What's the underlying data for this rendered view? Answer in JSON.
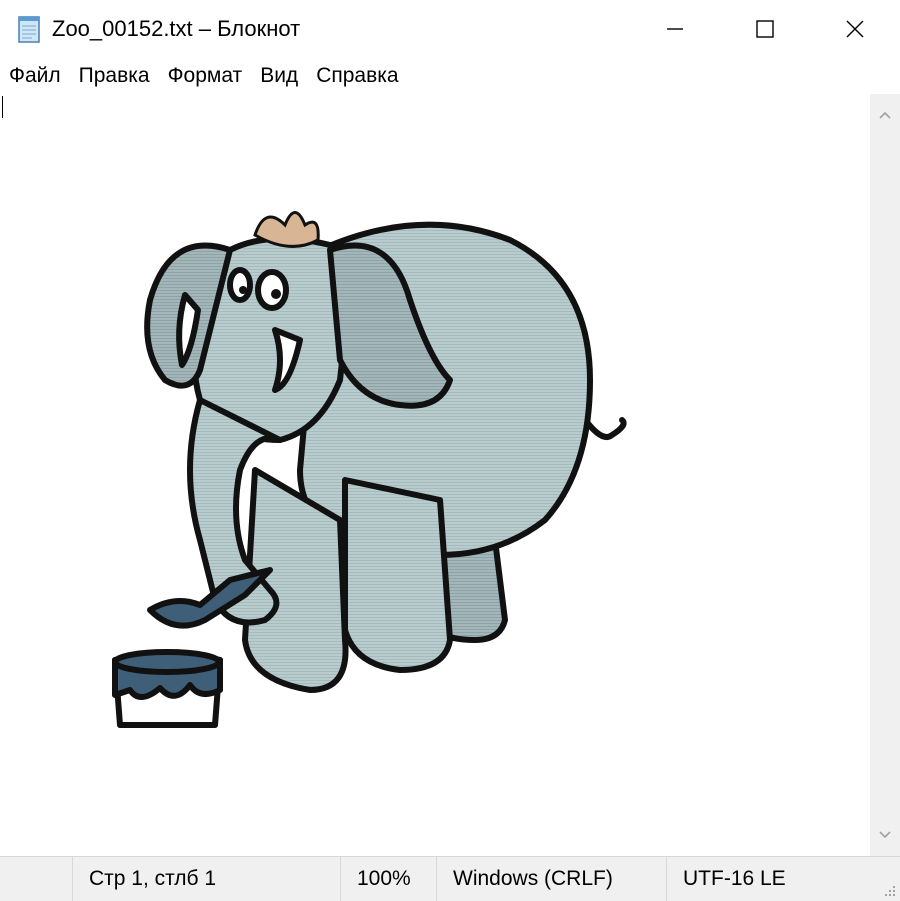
{
  "window": {
    "title": "Zoo_00152.txt – Блокнот",
    "icons": {
      "app": "notepad-icon",
      "minimize": "minimize-icon",
      "maximize": "maximize-icon",
      "close": "close-icon"
    }
  },
  "menu": {
    "items": [
      {
        "label": "Файл"
      },
      {
        "label": "Правка"
      },
      {
        "label": "Формат"
      },
      {
        "label": "Вид"
      },
      {
        "label": "Справка"
      }
    ]
  },
  "editor": {
    "content": "elephant-ascii-art",
    "colors": {
      "body": "#b8cccd",
      "shade": "#9fb3b6",
      "outline": "#111111",
      "paint": "#3f5f78",
      "hair": "#d8b595",
      "tusk": "#ffffff"
    }
  },
  "status": {
    "position": "Стр 1, стлб 1",
    "zoom": "100%",
    "line_endings": "Windows (CRLF)",
    "encoding": "UTF-16 LE"
  }
}
